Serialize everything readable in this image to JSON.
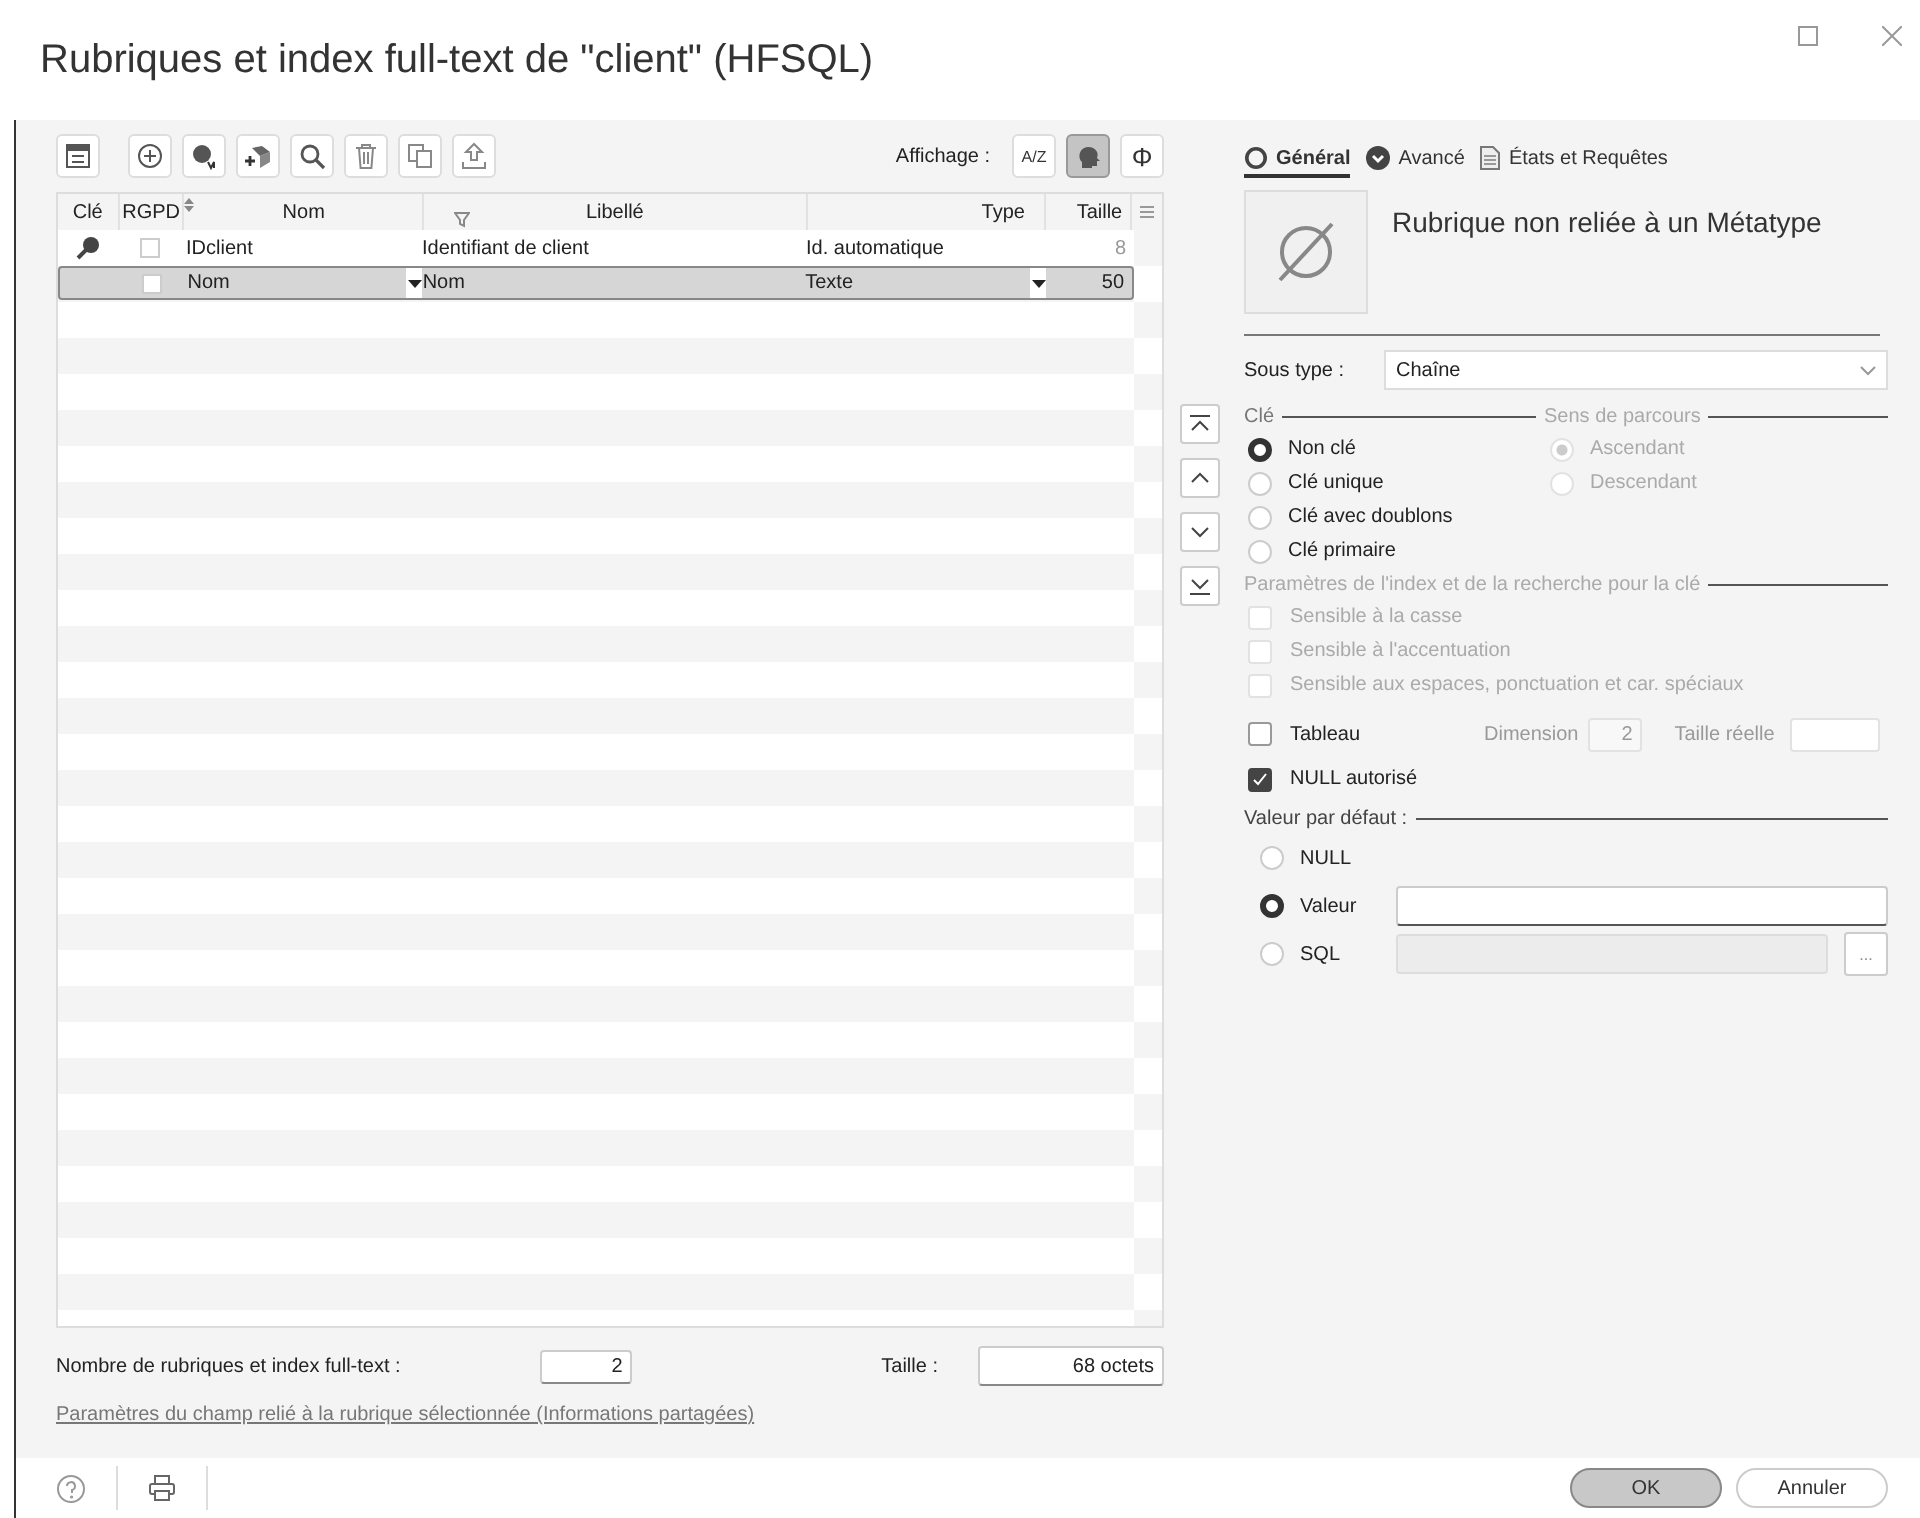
{
  "window": {
    "title": "Rubriques et index full-text de \"client\" (HFSQL)"
  },
  "toolbar": {
    "buttons": [
      {
        "kind": "grid"
      },
      {
        "kind": "add"
      },
      {
        "kind": "add-m"
      },
      {
        "kind": "add-cube"
      },
      {
        "kind": "search"
      },
      {
        "kind": "delete"
      },
      {
        "kind": "copy"
      },
      {
        "kind": "export"
      }
    ],
    "view_label": "Affichage :",
    "view_buttons": [
      {
        "kind": "text",
        "label": "A/Z",
        "selected": false
      },
      {
        "kind": "head",
        "selected": true
      },
      {
        "kind": "text",
        "label": "Φ",
        "selected": false
      }
    ]
  },
  "table": {
    "columns": [
      "Clé",
      "RGPD",
      "Nom",
      "Libellé",
      "Type",
      "Taille"
    ],
    "rows": [
      {
        "key": true,
        "rgpd": false,
        "nom": "IDclient",
        "libelle": "Identifiant de client",
        "type": "Id. automatique",
        "taille": "8",
        "selected": false
      },
      {
        "key": false,
        "rgpd": false,
        "nom": "Nom",
        "libelle": "Nom",
        "type": "Texte",
        "taille": "50",
        "selected": true
      }
    ]
  },
  "summary": {
    "count_label": "Nombre de rubriques et index full-text :",
    "count": "2",
    "size_label": "Taille :",
    "size": "68 octets"
  },
  "link": "Paramètres du champ relié à la rubrique sélectionnée (Informations partagées)",
  "move_buttons": [
    {
      "kind": "first"
    },
    {
      "kind": "up"
    },
    {
      "kind": "down"
    },
    {
      "kind": "last"
    }
  ],
  "tabs": [
    {
      "label": "Général",
      "kind": "ring",
      "selected": true
    },
    {
      "label": "Avancé",
      "kind": "badge",
      "selected": false
    },
    {
      "label": "États et Requêtes",
      "kind": "document",
      "selected": false
    }
  ],
  "metatype": "Rubrique non reliée à un Métatype",
  "sous_type": {
    "label": "Sous type :",
    "value": "Chaîne"
  },
  "cle": {
    "legend": "Clé",
    "options": [
      {
        "label": "Non clé",
        "selected": true
      },
      {
        "label": "Clé unique",
        "selected": false
      },
      {
        "label": "Clé avec doublons",
        "selected": false
      },
      {
        "label": "Clé primaire",
        "selected": false
      }
    ]
  },
  "sens": {
    "legend": "Sens de parcours",
    "disabled": true,
    "options": [
      {
        "label": "Ascendant",
        "selected": true
      },
      {
        "label": "Descendant",
        "selected": false
      }
    ]
  },
  "index_params": {
    "legend": "Paramètres de l'index et de la recherche pour la clé",
    "disabled": true,
    "options": [
      {
        "label": "Sensible à la casse",
        "checked": false
      },
      {
        "label": "Sensible à l'accentuation",
        "checked": false
      },
      {
        "label": "Sensible aux espaces, ponctuation et car. spéciaux",
        "checked": false
      }
    ]
  },
  "tableau": {
    "label": "Tableau",
    "checked": false,
    "dimension_label": "Dimension",
    "dimension": "2",
    "size_label": "Taille réelle"
  },
  "null_allowed": {
    "label": "NULL autorisé",
    "checked": true
  },
  "default": {
    "legend": "Valeur par défaut :",
    "options": [
      {
        "label": "NULL",
        "kind": "plain",
        "selected": false
      },
      {
        "label": "Valeur",
        "kind": "input",
        "selected": true
      },
      {
        "label": "SQL",
        "kind": "sql",
        "selected": false
      }
    ],
    "sql_button": "..."
  },
  "buttons": [
    {
      "label": "OK",
      "primary": true
    },
    {
      "label": "Annuler",
      "primary": false
    }
  ]
}
